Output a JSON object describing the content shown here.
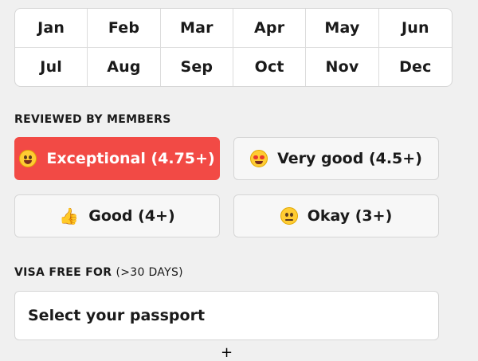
{
  "months": [
    "Jan",
    "Feb",
    "Mar",
    "Apr",
    "May",
    "Jun",
    "Jul",
    "Aug",
    "Sep",
    "Oct",
    "Nov",
    "Dec"
  ],
  "reviewed": {
    "label": "REVIEWED BY MEMBERS",
    "options": [
      {
        "label": "Exceptional (4.75+)",
        "icon": "star-struck-emoji-icon",
        "selected": true
      },
      {
        "label": "Very good (4.5+)",
        "icon": "heart-eyes-emoji-icon",
        "selected": false
      },
      {
        "label": "Good (4+)",
        "icon": "thumbs-up-icon",
        "selected": false
      },
      {
        "label": "Okay (3+)",
        "icon": "neutral-face-emoji-icon",
        "selected": false
      }
    ]
  },
  "visa": {
    "label": "VISA FREE FOR",
    "sublabel": "(>30 DAYS)",
    "passport_placeholder": "Select your passport"
  },
  "cursor_icon": "crosshair-cursor-icon",
  "colors": {
    "selected_bg": "#f24a45",
    "page_bg": "#f0f0f0"
  }
}
